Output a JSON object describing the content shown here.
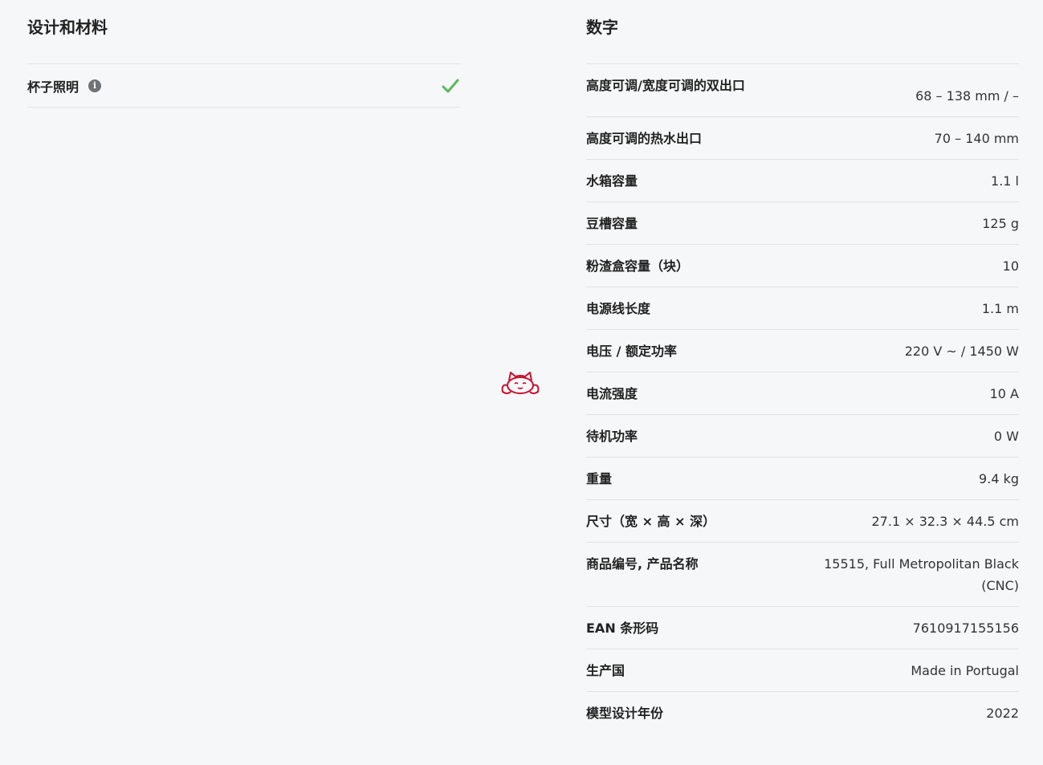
{
  "left_section": {
    "title": "设计和材料",
    "rows": [
      {
        "label": "杯子照明",
        "icon": "info-icon",
        "status_icon": "check-icon",
        "status_color": "#5cb85c"
      }
    ]
  },
  "right_section": {
    "title": "数字",
    "rows": [
      {
        "label": "高度可调/宽度可调的双出口",
        "value": "68 – 138 mm / –"
      },
      {
        "label": "高度可调的热水出口",
        "value": "70 – 140 mm"
      },
      {
        "label": "水箱容量",
        "value": "1.1 l"
      },
      {
        "label": "豆槽容量",
        "value": "125 g"
      },
      {
        "label": "粉渣盒容量（块）",
        "value": "10"
      },
      {
        "label": "电源线长度",
        "value": "1.1 m"
      },
      {
        "label": "电压 / 额定功率",
        "value": "220 V ~ / 1450 W"
      },
      {
        "label": "电流强度",
        "value": "10 A"
      },
      {
        "label": "待机功率",
        "value": "0 W"
      },
      {
        "label": "重量",
        "value": "9.4 kg"
      },
      {
        "label": "尺寸（宽 × 高 × 深）",
        "value": "27.1 × 32.3 × 44.5 cm"
      },
      {
        "label": "商品编号, 产品名称",
        "value": "15515, Full Metropolitan Black (CNC)"
      },
      {
        "label": "EAN 条形码",
        "value": "7610917155156"
      },
      {
        "label": "生产国",
        "value": "Made in Portugal"
      },
      {
        "label": "模型设计年份",
        "value": "2022"
      }
    ]
  },
  "overlay": {
    "icon": "cat-mascot-icon",
    "color": "#c8102e"
  }
}
